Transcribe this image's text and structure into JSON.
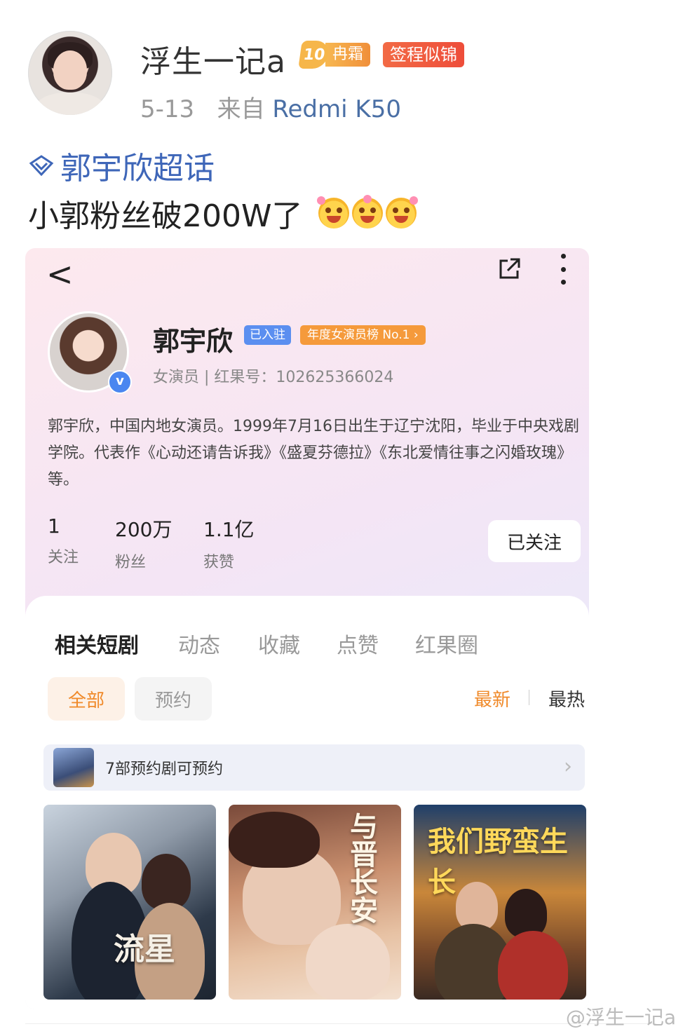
{
  "post": {
    "username": "浮生一记a",
    "vip_level": "10",
    "vip_label": "冉霜",
    "tag_badge": "签程似锦",
    "date": "5-13",
    "source_prefix": "来自",
    "device": "Redmi K50",
    "topic": "郭宇欣超话",
    "text": "小郭粉丝破200W了"
  },
  "app": {
    "profile": {
      "name": "郭宇欣",
      "joined_badge": "已入驻",
      "rank_badge": "年度女演员榜 No.1 ›",
      "verified_mark": "v",
      "subtitle": "女演员 | 红果号：102625366024",
      "bio": "郭宇欣，中国内地女演员。1999年7月16日出生于辽宁沈阳，毕业于中央戏剧学院。代表作《心动还请告诉我》《盛夏芬德拉》《东北爱情往事之闪婚玫瑰》等。"
    },
    "stats": [
      {
        "value": "1",
        "label": "关注"
      },
      {
        "value": "200万",
        "label": "粉丝"
      },
      {
        "value": "1.1亿",
        "label": "获赞"
      }
    ],
    "follow_button": "已关注",
    "tabs": [
      "相关短剧",
      "动态",
      "收藏",
      "点赞",
      "红果圈"
    ],
    "filters": {
      "all": "全部",
      "reserve": "预约"
    },
    "sort": {
      "newest": "最新",
      "hottest": "最热"
    },
    "reserve_bar": "7部预约剧可预约",
    "posters": [
      {
        "title": "流星"
      },
      {
        "title": "与晋长安"
      },
      {
        "title": "我们野蛮生长"
      }
    ]
  },
  "watermark": "@浮生一记a",
  "colors": {
    "accent_orange": "#f08a2a",
    "link_blue": "#3e66b8",
    "badge_blue": "#5b8ff0"
  }
}
